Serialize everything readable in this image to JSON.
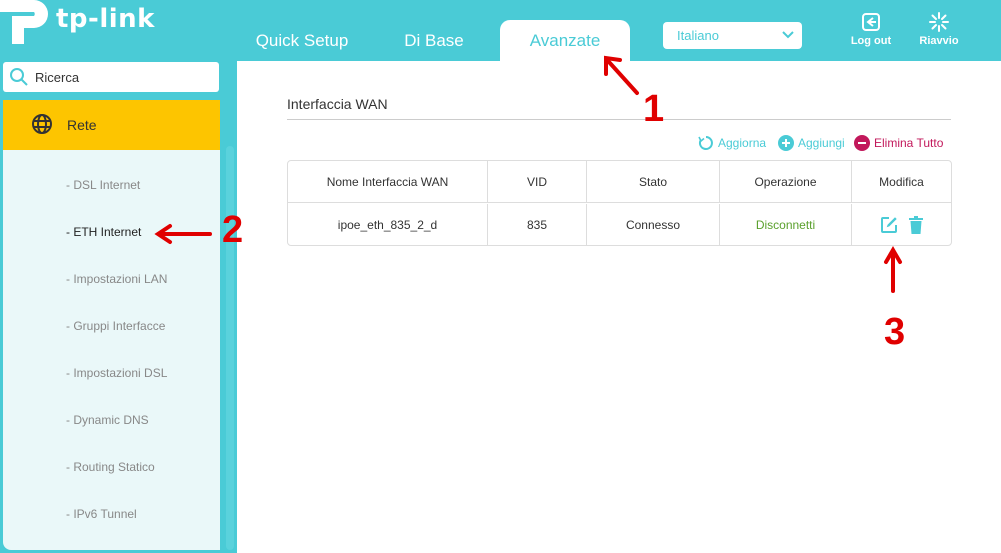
{
  "brand": {
    "logo_text": "tp-link"
  },
  "nav": {
    "tabs": [
      {
        "label": "Quick Setup"
      },
      {
        "label": "Di Base"
      },
      {
        "label": "Avanzate",
        "active": true
      }
    ]
  },
  "language": {
    "selected": "Italiano"
  },
  "header_buttons": {
    "logout_label": "Log out",
    "reboot_label": "Riavvio"
  },
  "sidebar": {
    "search_placeholder": "Ricerca",
    "section": {
      "label": "Rete",
      "icon": "globe-icon"
    },
    "items": [
      {
        "label": "- DSL Internet"
      },
      {
        "label": "- ETH Internet",
        "active": true
      },
      {
        "label": "- Impostazioni LAN"
      },
      {
        "label": "- Gruppi Interfacce"
      },
      {
        "label": "- Impostazioni DSL"
      },
      {
        "label": "- Dynamic DNS"
      },
      {
        "label": "- Routing Statico"
      },
      {
        "label": "- IPv6 Tunnel"
      }
    ]
  },
  "main": {
    "title": "Interfaccia WAN",
    "actions": {
      "refresh": "Aggiorna",
      "add": "Aggiungi",
      "delete_all": "Elimina Tutto"
    },
    "table": {
      "headers": [
        "Nome Interfaccia WAN",
        "VID",
        "Stato",
        "Operazione",
        "Modifica"
      ],
      "rows": [
        {
          "name": "ipoe_eth_835_2_d",
          "vid": "835",
          "status": "Connesso",
          "operation": "Disconnetti"
        }
      ]
    }
  },
  "annotations": [
    "1",
    "2",
    "3"
  ],
  "colors": {
    "accent": "#4acbd6",
    "active_menu": "#fdc500",
    "operation_link": "#5aa02c",
    "delete": "#c2185b",
    "annotation": "#e00000"
  }
}
